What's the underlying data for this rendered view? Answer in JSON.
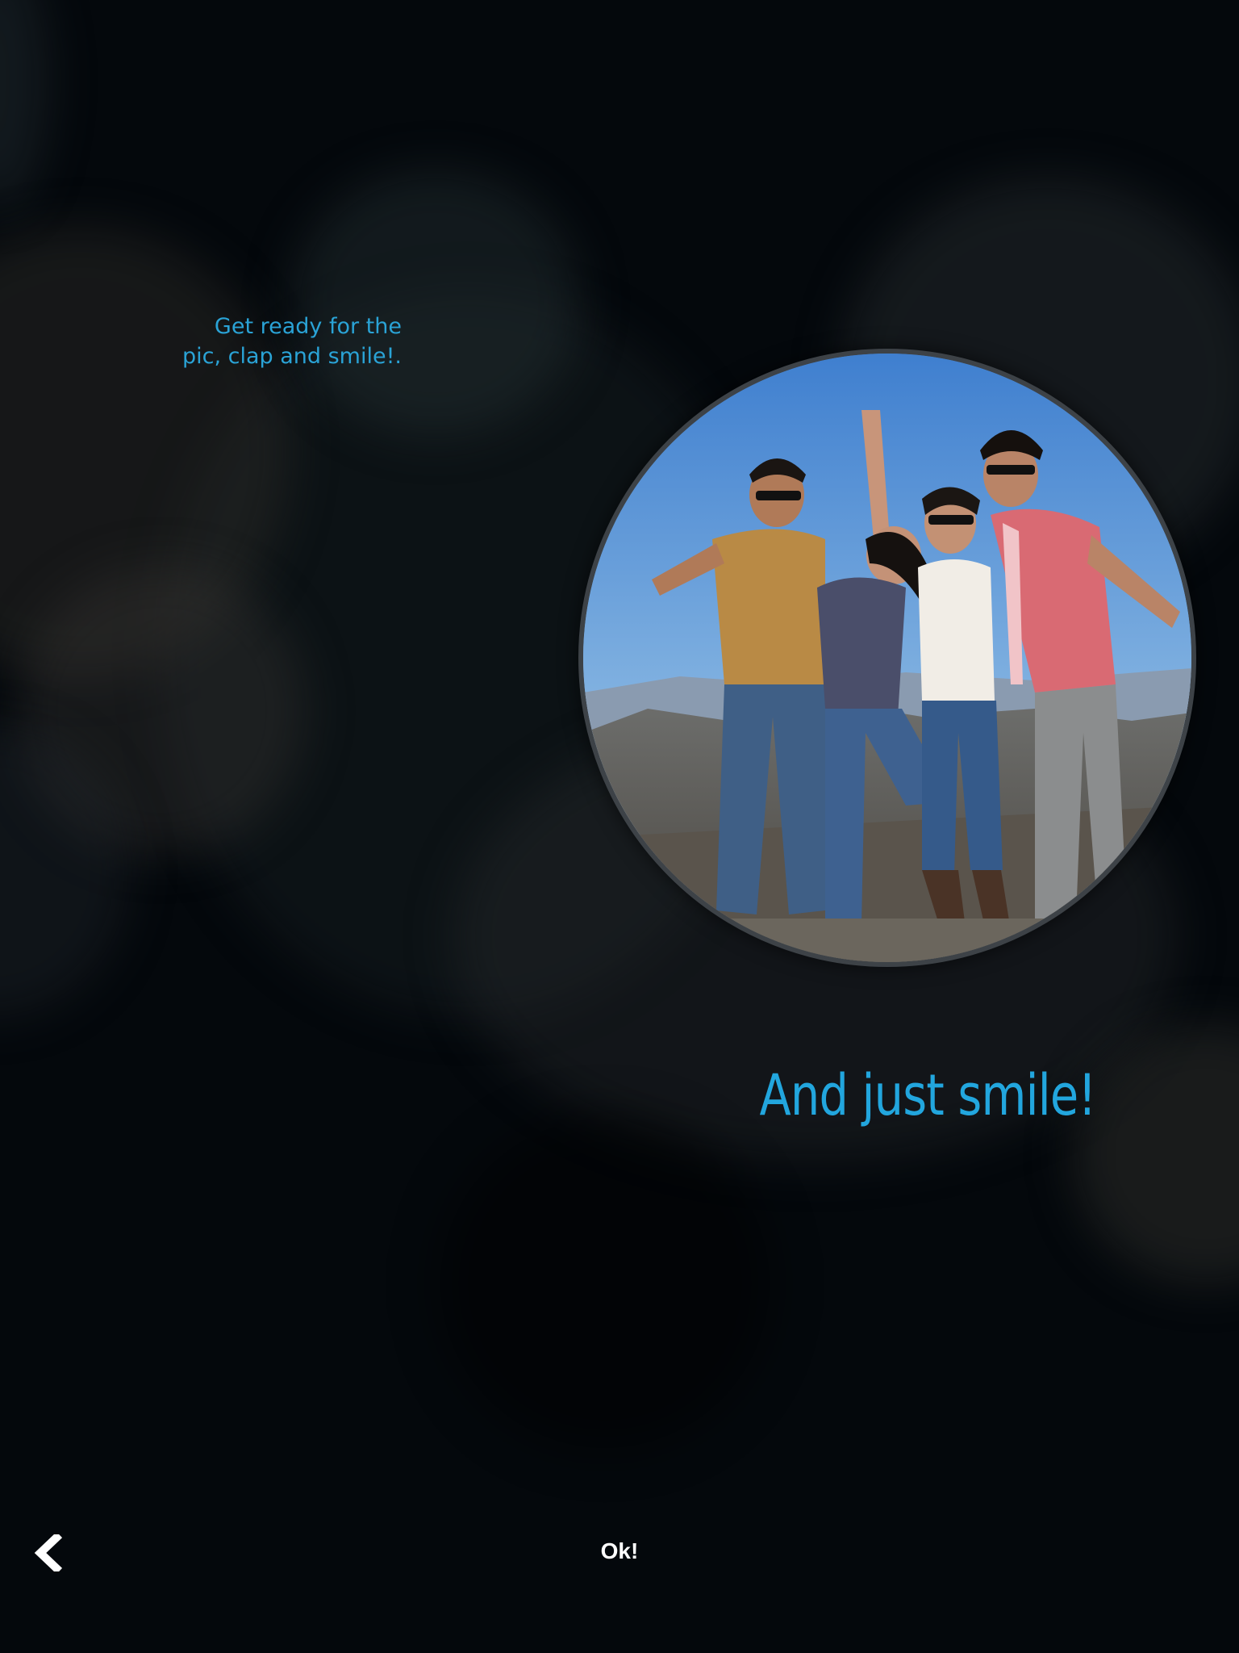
{
  "intro": {
    "line1": "Get ready for the",
    "line2": "pic, clap and smile!."
  },
  "photo": {
    "icon": "group-photo"
  },
  "headline": "And just smile!",
  "footer": {
    "back_icon": "chevron-left-icon",
    "ok_label": "Ok!"
  },
  "colors": {
    "accent": "#22a6de",
    "background": "#04080c",
    "button_text": "#ffffff"
  }
}
